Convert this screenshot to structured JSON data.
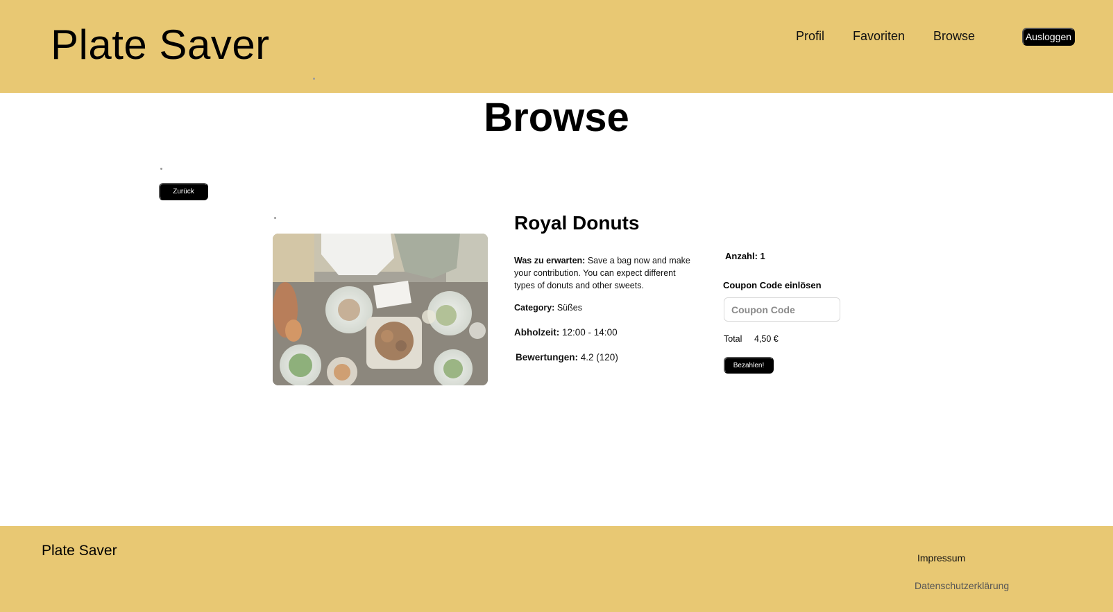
{
  "header": {
    "brand": "Plate Saver",
    "nav": {
      "profil": "Profil",
      "favoriten": "Favoriten",
      "browse": "Browse"
    },
    "logout_label": "Ausloggen"
  },
  "page_title": "Browse",
  "back_label": "Zurück",
  "image": {
    "icon": "food-table-photo"
  },
  "product": {
    "name": "Royal Donuts",
    "expect_label": "Was zu erwarten:",
    "expect_text": "Save a bag now and make your contribution. You can expect different types of donuts and other sweets.",
    "category_label": "Category:",
    "category_value": "Süßes",
    "pickup_label": "Abholzeit:",
    "pickup_value": "12:00 - 14:00",
    "rating_label": "Bewertungen:",
    "rating_value": "4.2 (120)"
  },
  "purchase": {
    "quantity": "Anzahl: 1",
    "coupon_label": "Coupon Code einlösen",
    "coupon_placeholder": "Coupon Code",
    "total_label": "Total",
    "total_value": "4,50 €",
    "pay_label": "Bezahlen!"
  },
  "footer": {
    "brand": "Plate Saver",
    "impressum": "Impressum",
    "datenschutz": "Datenschutzerklärung"
  },
  "colors": {
    "header_bg": "#e8c873",
    "button_bg": "#000000",
    "button_text": "#ffffff"
  }
}
